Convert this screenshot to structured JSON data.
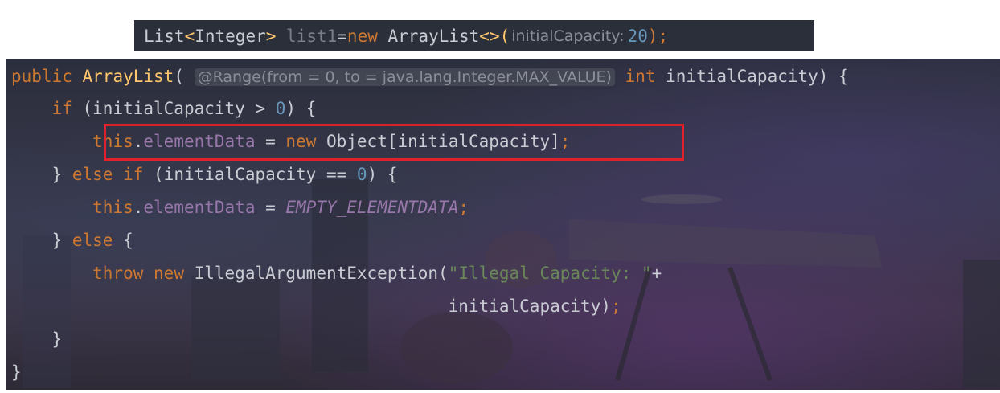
{
  "snippet": {
    "t1": "List",
    "t2": "<",
    "t3": "Integer",
    "t4": "> ",
    "t5": "list1",
    "t6": "=",
    "t7": "new",
    "t8": " ArrayList",
    "t9": "<>(",
    "hint": "initialCapacity:",
    "t10": "20",
    "t11": ");"
  },
  "code": {
    "l1": {
      "a": "public",
      "b": " ",
      "c": "ArrayList",
      "d": "( ",
      "hint": "@Range(from = 0, to = java.lang.Integer.MAX_VALUE)",
      "e": " ",
      "f": "int",
      "g": " initialCapacity) {"
    },
    "l2": {
      "a": "    ",
      "b": "if",
      "c": " (initialCapacity > ",
      "d": "0",
      "e": ") {"
    },
    "l3": {
      "a": "        ",
      "b": "this",
      "c": ".",
      "d": "elementData",
      "e": " = ",
      "f": "new",
      "g": " Object[initialCapacity]",
      "h": ";"
    },
    "l4": {
      "a": "    } ",
      "b": "else",
      "c": " ",
      "d": "if",
      "e": " (initialCapacity == ",
      "f": "0",
      "g": ") {"
    },
    "l5": {
      "a": "        ",
      "b": "this",
      "c": ".",
      "d": "elementData",
      "e": " = ",
      "f": "EMPTY_ELEMENTDATA",
      "g": ";"
    },
    "l6": {
      "a": "    } ",
      "b": "else",
      "c": " {"
    },
    "l7": {
      "a": "        ",
      "b": "throw",
      "c": " ",
      "d": "new",
      "e": " IllegalArgumentException(",
      "f": "\"Illegal Capacity: \"",
      "g": "+"
    },
    "l8": {
      "a": "                                           initialCapacity)",
      "b": ";"
    },
    "l9": {
      "a": "    }"
    },
    "l10": {
      "a": "}"
    }
  },
  "colors": {
    "keyword": "#cc7832",
    "method": "#ffc66d",
    "field": "#9876aa",
    "number": "#6897bb",
    "string": "#6a8759",
    "highlight_border": "#e0202a"
  }
}
